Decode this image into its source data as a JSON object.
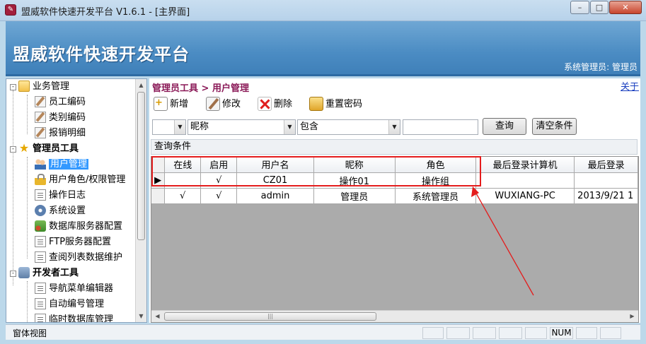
{
  "window": {
    "title": "盟威软件快速开发平台 V1.6.1 - [主界面]",
    "app_icon_glyph": "✎",
    "controls": {
      "minimize": "–",
      "maximize": "□",
      "close": "✕"
    }
  },
  "header": {
    "app_name": "盟威软件快速开发平台",
    "user_info": "系统管理员: 管理员"
  },
  "sidebar": {
    "scroll_up": "▲",
    "scroll_down": "▼",
    "groups": [
      {
        "label": "业务管理",
        "toggle": "-",
        "icon": "folder-icon",
        "items": [
          {
            "label": "员工编码",
            "icon": "edit-icon"
          },
          {
            "label": "类别编码",
            "icon": "edit-icon"
          },
          {
            "label": "报销明细",
            "icon": "edit-icon"
          }
        ]
      },
      {
        "label": "管理员工具",
        "toggle": "-",
        "icon": "star-icon",
        "items": [
          {
            "label": "用户管理",
            "icon": "users-icon",
            "selected": true
          },
          {
            "label": "用户角色/权限管理",
            "icon": "lock-icon"
          },
          {
            "label": "操作日志",
            "icon": "document-icon"
          },
          {
            "label": "系统设置",
            "icon": "gear-icon"
          },
          {
            "label": "数据库服务器配置",
            "icon": "database-icon"
          },
          {
            "label": "FTP服务器配置",
            "icon": "document-icon"
          },
          {
            "label": "查阅列表数据维护",
            "icon": "document-icon"
          }
        ]
      },
      {
        "label": "开发者工具",
        "toggle": "-",
        "icon": "tools-icon",
        "items": [
          {
            "label": "导航菜单编辑器",
            "icon": "document-icon"
          },
          {
            "label": "自动编号管理",
            "icon": "document-icon"
          },
          {
            "label": "临时数据库管理",
            "icon": "document-icon"
          }
        ]
      }
    ]
  },
  "content": {
    "breadcrumb": "管理员工具 > 用户管理",
    "about_link": "关于",
    "toolbar": {
      "new_label": "新增",
      "modify_label": "修改",
      "delete_label": "删除",
      "reset_password_label": "重置密码"
    },
    "search": {
      "prefix_value": "",
      "field_value": "昵称",
      "operator_value": "包含",
      "keyword_value": "",
      "dropdown_glyph": "▼",
      "query_button": "查询",
      "clear_button": "清空条件"
    },
    "query_conditions_label": "查询条件",
    "grid": {
      "row_indicator": "▶",
      "columns": [
        "在线",
        "启用",
        "用户名",
        "昵称",
        "角色",
        "最后登录计算机",
        "最后登录"
      ],
      "rows": [
        [
          "",
          "√",
          "CZ01",
          "操作01",
          "操作组",
          "",
          ""
        ],
        [
          "√",
          "√",
          "admin",
          "管理员",
          "系统管理员",
          "WUXIANG-PC",
          "2013/9/21 1"
        ]
      ],
      "hscroll": {
        "left": "◀",
        "right": "▶",
        "grip": "|||"
      }
    }
  },
  "statusbar": {
    "text": "窗体视图",
    "num_indicator": "NUM"
  },
  "annotation": {
    "highlight_color": "#e41c1c"
  }
}
